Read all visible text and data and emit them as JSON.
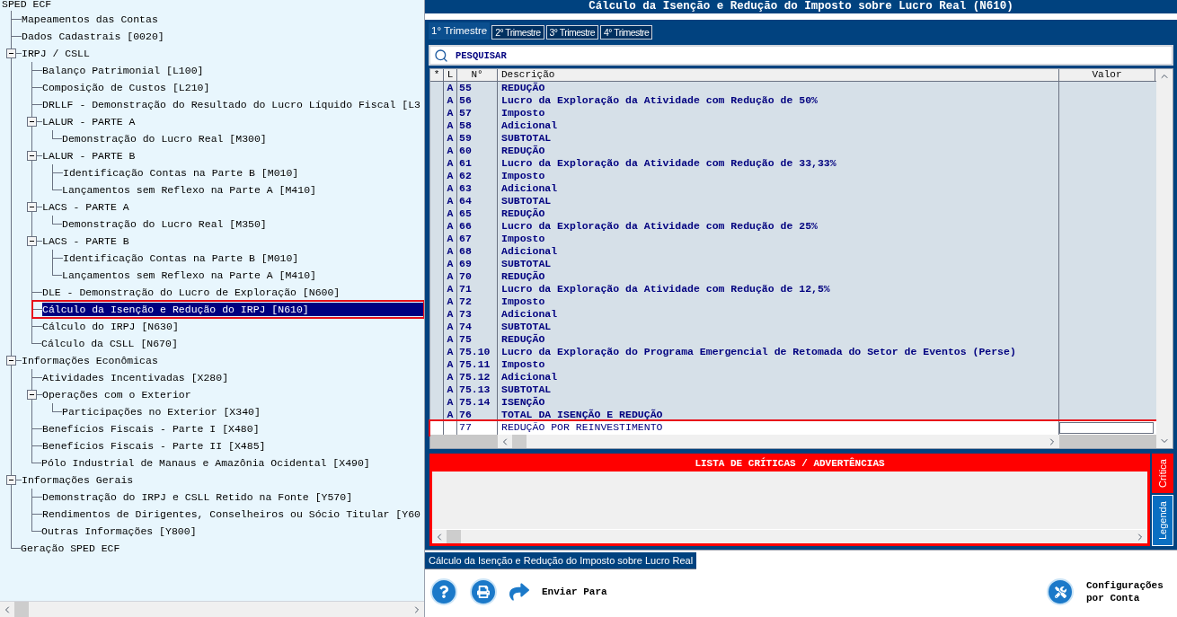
{
  "tree": {
    "root": "SPED ECF",
    "items": [
      {
        "label": "Mapeamentos das Contas",
        "selected": false
      },
      {
        "label": "Dados Cadastrais [0020]",
        "selected": false
      },
      {
        "label": "IRPJ / CSLL",
        "selected": false,
        "expanded": true,
        "children": [
          {
            "label": "Balanço Patrimonial [L100]",
            "selected": false
          },
          {
            "label": "Composição de Custos [L210]",
            "selected": false
          },
          {
            "label": "DRLLF - Demonstração do Resultado do Lucro Líquido Fiscal [L3",
            "selected": false
          },
          {
            "label": "LALUR - PARTE A",
            "selected": false,
            "expanded": true,
            "children": [
              {
                "label": "Demonstração do Lucro Real [M300]",
                "selected": false
              }
            ]
          },
          {
            "label": "LALUR - PARTE B",
            "selected": false,
            "expanded": true,
            "children": [
              {
                "label": "Identificação Contas na Parte B [M010]",
                "selected": false
              },
              {
                "label": "Lançamentos sem Reflexo na Parte A [M410]",
                "selected": false
              }
            ]
          },
          {
            "label": "LACS - PARTE A",
            "selected": false,
            "expanded": true,
            "children": [
              {
                "label": "Demonstração do Lucro Real [M350]",
                "selected": false
              }
            ]
          },
          {
            "label": "LACS - PARTE B",
            "selected": false,
            "expanded": true,
            "children": [
              {
                "label": "Identificação Contas na Parte B [M010]",
                "selected": false
              },
              {
                "label": "Lançamentos sem Reflexo na Parte A [M410]",
                "selected": false
              }
            ]
          },
          {
            "label": "DLE - Demonstração do Lucro de Exploração [N600]",
            "selected": false
          },
          {
            "label": "Cálculo da Isenção e Redução do IRPJ [N610]",
            "selected": true
          },
          {
            "label": "Cálculo do IRPJ [N630]",
            "selected": false
          },
          {
            "label": "Cálculo da CSLL [N670]",
            "selected": false
          }
        ]
      },
      {
        "label": "Informações Econômicas",
        "selected": false,
        "expanded": true,
        "children": [
          {
            "label": "Atividades Incentivadas [X280]",
            "selected": false
          },
          {
            "label": "Operações com o Exterior",
            "selected": false,
            "expanded": true,
            "children": [
              {
                "label": "Participações no Exterior [X340]",
                "selected": false
              }
            ]
          },
          {
            "label": "Benefícios Fiscais - Parte I [X480]",
            "selected": false
          },
          {
            "label": "Benefícios Fiscais - Parte II [X485]",
            "selected": false
          },
          {
            "label": "Pólo Industrial de Manaus e Amazônia Ocidental [X490]",
            "selected": false
          }
        ]
      },
      {
        "label": "Informações Gerais",
        "selected": false,
        "expanded": true,
        "children": [
          {
            "label": "Demonstração do IRPJ e CSLL Retido na Fonte [Y570]",
            "selected": false
          },
          {
            "label": "Rendimentos de Dirigentes, Conselheiros ou Sócio Titular [Y60",
            "selected": false
          },
          {
            "label": "Outras Informações [Y800]",
            "selected": false
          }
        ]
      },
      {
        "label": "Geração SPED ECF",
        "selected": false
      }
    ]
  },
  "window": {
    "title": "Cálculo da Isenção e Redução do Imposto sobre Lucro Real (N610)"
  },
  "tabs": [
    {
      "label": "1° Trimestre",
      "selected": true
    },
    {
      "label": "2° Trimestre",
      "selected": false
    },
    {
      "label": "3° Trimestre",
      "selected": false
    },
    {
      "label": "4° Trimestre",
      "selected": false
    }
  ],
  "search": {
    "placeholder": "PESQUISAR"
  },
  "table": {
    "columns": [
      "*",
      "L",
      "N°",
      "Descrição",
      "Valor"
    ],
    "rows": [
      {
        "l": "A",
        "n": "55",
        "description": "REDUÇÃO",
        "kind": "total",
        "selected": false
      },
      {
        "l": "A",
        "n": "56",
        "description": "Lucro da Exploração da Atividade com Redução de 50%",
        "kind": "total",
        "selected": false
      },
      {
        "l": "A",
        "n": "57",
        "description": "Imposto",
        "kind": "total",
        "selected": false
      },
      {
        "l": "A",
        "n": "58",
        "description": "Adicional",
        "kind": "total",
        "selected": false
      },
      {
        "l": "A",
        "n": "59",
        "description": "SUBTOTAL",
        "kind": "total",
        "selected": false
      },
      {
        "l": "A",
        "n": "60",
        "description": "REDUÇÃO",
        "kind": "total",
        "selected": false
      },
      {
        "l": "A",
        "n": "61",
        "description": "Lucro da Exploração da Atividade com Redução de 33,33%",
        "kind": "total",
        "selected": false
      },
      {
        "l": "A",
        "n": "62",
        "description": "Imposto",
        "kind": "total",
        "selected": false
      },
      {
        "l": "A",
        "n": "63",
        "description": "Adicional",
        "kind": "total",
        "selected": false
      },
      {
        "l": "A",
        "n": "64",
        "description": "SUBTOTAL",
        "kind": "total",
        "selected": false
      },
      {
        "l": "A",
        "n": "65",
        "description": "REDUÇÃO",
        "kind": "total",
        "selected": false
      },
      {
        "l": "A",
        "n": "66",
        "description": "Lucro da Exploração da Atividade com Redução de 25%",
        "kind": "total",
        "selected": false
      },
      {
        "l": "A",
        "n": "67",
        "description": "Imposto",
        "kind": "total",
        "selected": false
      },
      {
        "l": "A",
        "n": "68",
        "description": "Adicional",
        "kind": "total",
        "selected": false
      },
      {
        "l": "A",
        "n": "69",
        "description": "SUBTOTAL",
        "kind": "total",
        "selected": false
      },
      {
        "l": "A",
        "n": "70",
        "description": "REDUÇÃO",
        "kind": "total",
        "selected": false
      },
      {
        "l": "A",
        "n": "71",
        "description": "Lucro da Exploração da Atividade com Redução de 12,5%",
        "kind": "total",
        "selected": false
      },
      {
        "l": "A",
        "n": "72",
        "description": "Imposto",
        "kind": "total",
        "selected": false
      },
      {
        "l": "A",
        "n": "73",
        "description": "Adicional",
        "kind": "total",
        "selected": false
      },
      {
        "l": "A",
        "n": "74",
        "description": "SUBTOTAL",
        "kind": "total",
        "selected": false
      },
      {
        "l": "A",
        "n": "75",
        "description": "REDUÇÃO",
        "kind": "total",
        "selected": false
      },
      {
        "l": "A",
        "n": "75.10",
        "description": "Lucro da Exploração do Programa Emergencial de Retomada do Setor de Eventos (Perse)",
        "kind": "total",
        "selected": false
      },
      {
        "l": "A",
        "n": "75.11",
        "description": "Imposto",
        "kind": "total",
        "selected": false
      },
      {
        "l": "A",
        "n": "75.12",
        "description": "Adicional",
        "kind": "total",
        "selected": false
      },
      {
        "l": "A",
        "n": "75.13",
        "description": "SUBTOTAL",
        "kind": "total",
        "selected": false
      },
      {
        "l": "A",
        "n": "75.14",
        "description": "ISENÇÃO",
        "kind": "total",
        "selected": false
      },
      {
        "l": "A",
        "n": "76",
        "description": "TOTAL DA ISENÇÃO E REDUÇÃO",
        "kind": "total",
        "selected": false
      },
      {
        "n": "77",
        "description": "REDUÇÃO POR REINVESTIMENTO",
        "kind": "input",
        "selected": true
      }
    ]
  },
  "messages": {
    "title": "LISTA DE CRÍTICAS / ADVERTÊNCIAS",
    "side_tabs": [
      {
        "label": "Crítica",
        "selected": true
      },
      {
        "label": "Legenda",
        "selected": false
      }
    ]
  },
  "page_tab": "Cálculo da Isenção e Redução do Imposto sobre Lucro Real",
  "toolbar": {
    "send": "Enviar Para",
    "settings": "Configurações por Conta"
  }
}
